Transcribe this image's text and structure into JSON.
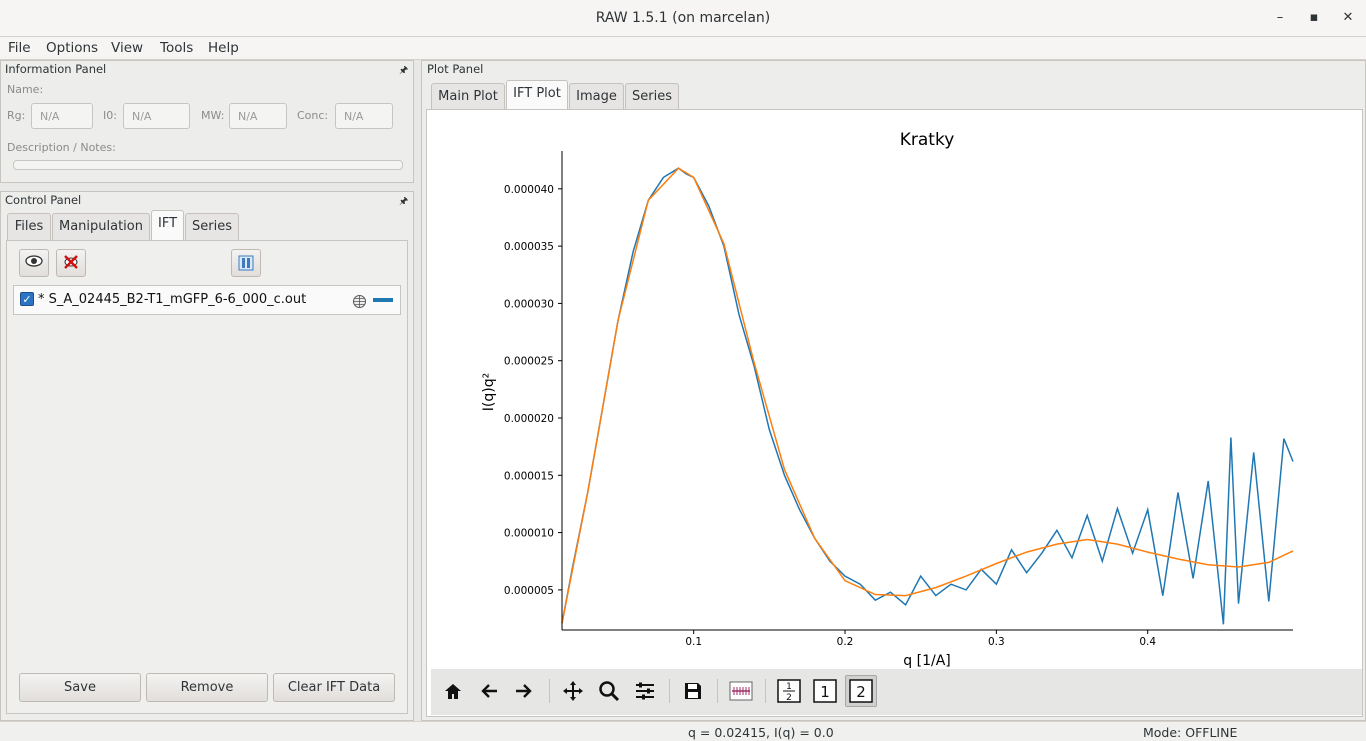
{
  "window": {
    "title": "RAW 1.5.1 (on marcelan)",
    "minimize": "–",
    "maximize": "▪",
    "close": "✕"
  },
  "menu": [
    "File",
    "Options",
    "View",
    "Tools",
    "Help"
  ],
  "info_panel": {
    "title": "Information Panel",
    "name_label": "Name:",
    "rg_label": "Rg:",
    "rg_value": "N/A",
    "i0_label": "I0:",
    "i0_value": "N/A",
    "mw_label": "MW:",
    "mw_value": "N/A",
    "conc_label": "Conc:",
    "conc_value": "N/A",
    "desc_label": "Description / Notes:"
  },
  "control_panel": {
    "title": "Control Panel",
    "tabs": [
      "Files",
      "Manipulation",
      "IFT",
      "Series"
    ],
    "active_tab": "IFT",
    "items": [
      {
        "checked": true,
        "name": "* S_A_02445_B2-T1_mGFP_6-6_000_c.out",
        "line_color": "#1f77b4"
      }
    ],
    "buttons": {
      "save": "Save",
      "remove": "Remove",
      "clear": "Clear IFT Data"
    }
  },
  "plot_panel": {
    "title": "Plot Panel",
    "tabs": [
      "Main Plot",
      "IFT Plot",
      "Image",
      "Series"
    ],
    "active_tab": "IFT Plot"
  },
  "status": {
    "coords": "q = 0.02415, I(q) = 0.0",
    "mode": "Mode: OFFLINE"
  },
  "chart_data": {
    "type": "line",
    "title": "Kratky",
    "xlabel": "q [1/A]",
    "ylabel": "I(q)q²",
    "xlim": [
      0.013,
      0.496
    ],
    "ylim": [
      1.5e-06,
      4.33e-05
    ],
    "xticks": [
      0.1,
      0.2,
      0.3,
      0.4
    ],
    "xtick_labels": [
      "0.1",
      "0.2",
      "0.3",
      "0.4"
    ],
    "yticks": [
      5e-06,
      1e-05,
      1.5e-05,
      2e-05,
      2.5e-05,
      3e-05,
      3.5e-05,
      4e-05
    ],
    "ytick_labels": [
      "0.000005",
      "0.000010",
      "0.000015",
      "0.000020",
      "0.000025",
      "0.000030",
      "0.000035",
      "0.000040"
    ],
    "series": [
      {
        "color": "#1f77b4",
        "x": [
          0.013,
          0.02,
          0.03,
          0.04,
          0.05,
          0.06,
          0.07,
          0.08,
          0.09,
          0.095,
          0.1,
          0.11,
          0.12,
          0.13,
          0.14,
          0.15,
          0.16,
          0.17,
          0.18,
          0.19,
          0.2,
          0.21,
          0.22,
          0.23,
          0.24,
          0.25,
          0.26,
          0.27,
          0.28,
          0.29,
          0.3,
          0.31,
          0.32,
          0.33,
          0.34,
          0.35,
          0.36,
          0.37,
          0.38,
          0.39,
          0.4,
          0.41,
          0.42,
          0.43,
          0.44,
          0.45,
          0.455,
          0.46,
          0.47,
          0.48,
          0.49,
          0.496
        ],
        "y": [
          2.1e-06,
          7e-06,
          1.35e-05,
          2.1e-05,
          2.85e-05,
          3.45e-05,
          3.9e-05,
          4.1e-05,
          4.18e-05,
          4.13e-05,
          4.1e-05,
          3.85e-05,
          3.5e-05,
          2.9e-05,
          2.45e-05,
          1.9e-05,
          1.5e-05,
          1.2e-05,
          9.5e-06,
          7.5e-06,
          6.2e-06,
          5.5e-06,
          4.1e-06,
          4.8e-06,
          3.7e-06,
          6.2e-06,
          4.5e-06,
          5.5e-06,
          5e-06,
          6.8e-06,
          5.5e-06,
          8.5e-06,
          6.5e-06,
          8.2e-06,
          1.02e-05,
          7.8e-06,
          1.15e-05,
          7.5e-06,
          1.21e-05,
          8.2e-06,
          1.2e-05,
          4.5e-06,
          1.35e-05,
          6e-06,
          1.45e-05,
          2e-06,
          1.83e-05,
          3.8e-06,
          1.7e-05,
          4e-06,
          1.82e-05,
          1.62e-05
        ]
      },
      {
        "color": "#ff7f0e",
        "x": [
          0.013,
          0.03,
          0.05,
          0.07,
          0.09,
          0.1,
          0.12,
          0.14,
          0.16,
          0.18,
          0.2,
          0.22,
          0.24,
          0.26,
          0.28,
          0.3,
          0.32,
          0.34,
          0.36,
          0.38,
          0.4,
          0.42,
          0.44,
          0.46,
          0.48,
          0.496
        ],
        "y": [
          2.1e-06,
          1.35e-05,
          2.85e-05,
          3.9e-05,
          4.18e-05,
          4.1e-05,
          3.52e-05,
          2.48e-05,
          1.55e-05,
          9.5e-06,
          5.8e-06,
          4.6e-06,
          4.5e-06,
          5.2e-06,
          6.2e-06,
          7.3e-06,
          8.3e-06,
          9e-06,
          9.4e-06,
          9e-06,
          8.3e-06,
          7.7e-06,
          7.2e-06,
          7e-06,
          7.4e-06,
          8.4e-06
        ]
      }
    ]
  }
}
